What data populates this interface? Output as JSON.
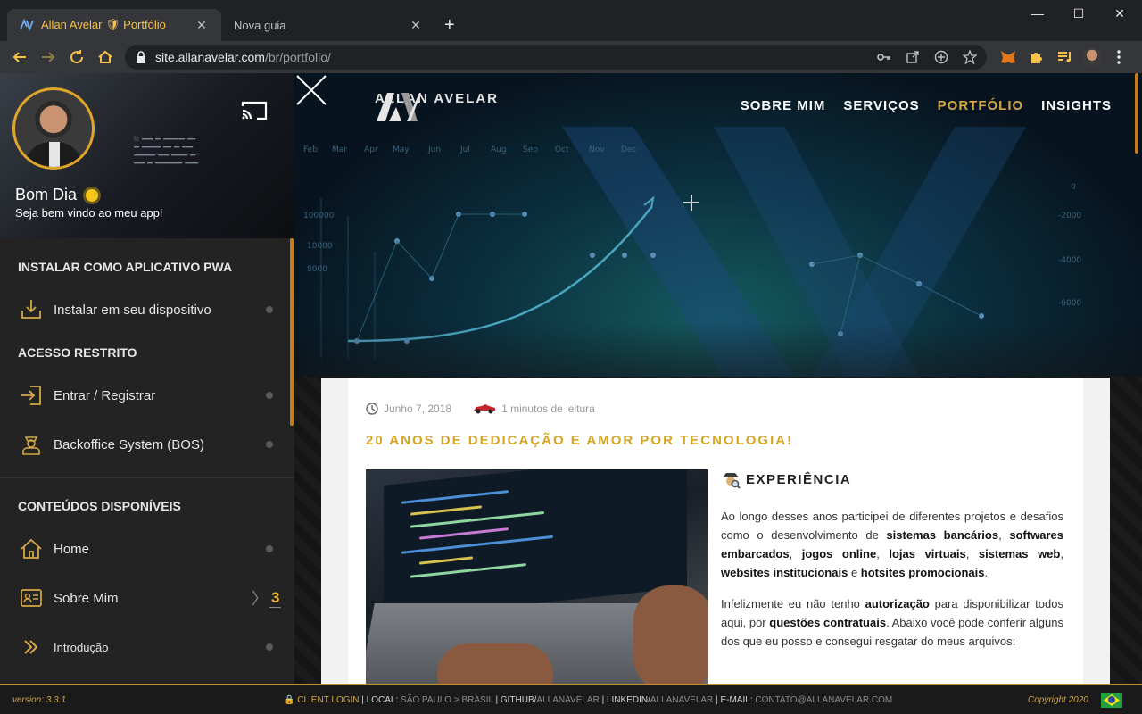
{
  "browser": {
    "tabs": [
      {
        "title": "Allan Avelar 🛡 Portfólio",
        "active": true
      },
      {
        "title": "Nova guia",
        "active": false
      }
    ],
    "new_tab": "+",
    "window_controls": {
      "minimize": "—",
      "maximize": "☐",
      "close": "✕"
    },
    "url_host": "site.allanavelar.com",
    "url_path": "/br/portfolio/"
  },
  "sidebar": {
    "greeting": "Bom Dia",
    "greeting_sub": "Seja bem vindo ao meu app!",
    "sections": {
      "pwa": "INSTALAR COMO APLICATIVO PWA",
      "restricted": "ACESSO RESTRITO",
      "contents": "CONTEÚDOS DISPONÍVEIS"
    },
    "items": [
      {
        "label": "Instalar em seu dispositivo",
        "icon": "download-icon"
      },
      {
        "label": "Entrar / Registrar",
        "icon": "login-icon"
      },
      {
        "label": "Backoffice System (BOS)",
        "icon": "agent-icon"
      },
      {
        "label": "Home",
        "icon": "home-icon"
      },
      {
        "label": "Sobre Mim",
        "icon": "id-card-icon",
        "badge": "3"
      },
      {
        "label": "Introdução",
        "icon": "double-chevron-icon"
      }
    ]
  },
  "header": {
    "brand": "ALLAN AVELAR",
    "nav": [
      "SOBRE MIM",
      "SERVIÇOS",
      "PORTFÓLIO",
      "INSIGHTS"
    ],
    "active_nav": "PORTFÓLIO"
  },
  "article": {
    "date": "Junho 7, 2018",
    "read_time": "1 minutos de leitura",
    "title": "20 ANOS DE DEDICAÇÃO E AMOR POR TECNOLOGIA!",
    "section_title": "EXPERIÊNCIA",
    "p1": {
      "t1": "Ao longo desses anos participei de diferentes projetos e desafios como o desenvolvimento de ",
      "b1": "sistemas bancários",
      "t2": ", ",
      "b2": "softwares embarcados",
      "t3": ", ",
      "b3": "jogos online",
      "t4": ", ",
      "b4": "lojas virtuais",
      "t5": ", ",
      "b5": "sistemas web",
      "t6": ", ",
      "b6": "websites institucionais",
      "t7": " e ",
      "b7": "hotsites promocionais",
      "t8": "."
    },
    "p2": {
      "t1": "Infelizmente eu não tenho ",
      "b1": "autorização",
      "t2": " para disponibilizar todos aqui, por ",
      "b2": "questões contratuais",
      "t3": ". Abaixo você pode conferir alguns dos que eu posso e consegui resgatar do meus arquivos:"
    }
  },
  "footer": {
    "version": "version: 3.3.1",
    "client_login": "CLIENT LOGIN",
    "local_label": "LOCAL:",
    "local_value": "SÃO PAULO > BRASIL",
    "github_label": "GITHUB/",
    "github_value": "ALLANAVELAR",
    "linkedin_label": "LINKEDIN/",
    "linkedin_value": "ALLANAVELAR",
    "email_label": "E-MAIL:",
    "email_value": "CONTATO@ALLANAVELAR.COM",
    "copyright": "Copyright 2020"
  },
  "colors": {
    "accent": "#d4a844",
    "tab_accent": "#f6c34a",
    "brazil_green": "#229e45"
  }
}
